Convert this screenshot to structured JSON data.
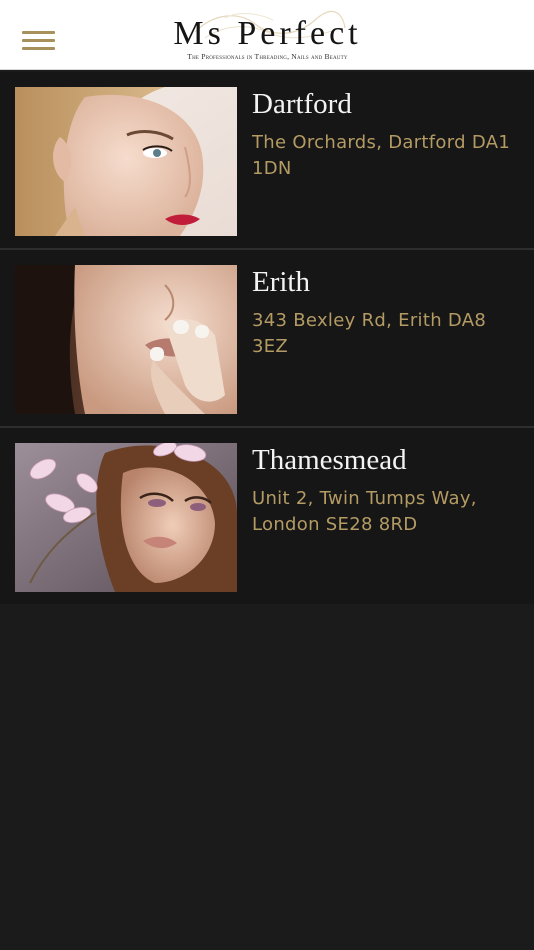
{
  "header": {
    "brand_title": "Ms Perfect",
    "brand_tagline": "The Professionals in Threading, Nails and Beauty",
    "menu_icon": "hamburger-menu-icon",
    "accent_color": "#a8905c"
  },
  "locations": [
    {
      "name": "Dartford",
      "address": "The Orchards, Dartford DA1 1DN"
    },
    {
      "name": "Erith",
      "address": "343 Bexley Rd, Erith DA8 3EZ"
    },
    {
      "name": "Thamesmead",
      "address": "Unit 2, Twin Tumps Way, London SE28 8RD"
    }
  ],
  "colors": {
    "background": "#1b1b1b",
    "list_background": "#161616",
    "name_text": "#f3f3f3",
    "address_text": "#b49b64"
  }
}
